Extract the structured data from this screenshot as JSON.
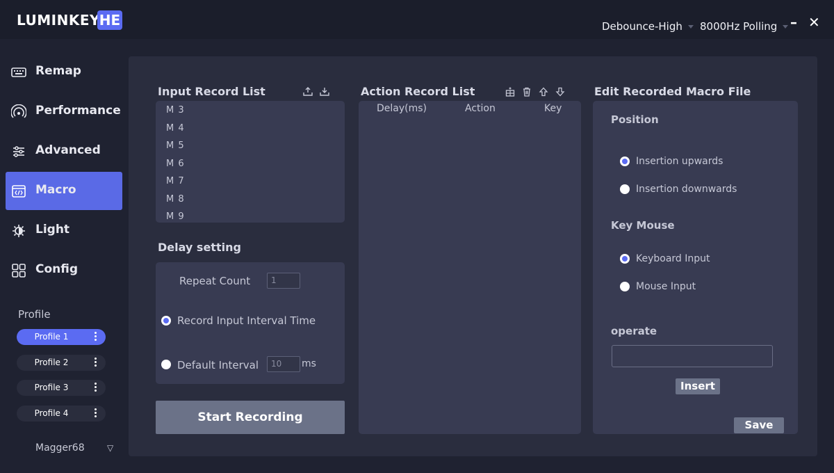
{
  "app": {
    "logo": "LUMINKEY",
    "logo_badge": "HE"
  },
  "titlebar": {
    "debounce": "Debounce-High",
    "polling": "8000Hz Polling",
    "minimize": "–",
    "close": "✕"
  },
  "sidebar": {
    "items": [
      {
        "label": "Remap",
        "icon": "keyboard-icon"
      },
      {
        "label": "Performance",
        "icon": "signal-icon"
      },
      {
        "label": "Advanced",
        "icon": "sliders-icon"
      },
      {
        "label": "Macro",
        "icon": "code-window-icon",
        "active": true
      },
      {
        "label": "Light",
        "icon": "sun-icon"
      },
      {
        "label": "Config",
        "icon": "grid-icon"
      }
    ],
    "profile_title": "Profile",
    "profiles": [
      "Profile 1",
      "Profile 2",
      "Profile 3",
      "Profile 4"
    ],
    "device": "Magger68",
    "device_caret": "▽"
  },
  "input_record": {
    "title": "Input Record List",
    "items": [
      "M 3",
      "M 4",
      "M 5",
      "M 6",
      "M 7",
      "M 8",
      "M 9"
    ]
  },
  "delay": {
    "title": "Delay setting",
    "repeat_label": "Repeat Count",
    "repeat_value": "1",
    "record_interval_label": "Record Input Interval Time",
    "default_interval_label": "Default Interval",
    "default_interval_value": "10",
    "unit": "ms"
  },
  "start_recording": "Start Recording",
  "action_record": {
    "title": "Action Record List",
    "columns": [
      "Delay(ms)",
      "Action",
      "Key"
    ]
  },
  "edit_macro": {
    "title": "Edit Recorded Macro File",
    "position_title": "Position",
    "insert_up": "Insertion upwards",
    "insert_down": "Insertion downwards",
    "keymouse_title": "Key Mouse",
    "keyboard_input": "Keyboard Input",
    "mouse_input": "Mouse Input",
    "operate_title": "operate",
    "insert_btn": "Insert",
    "save_btn": "Save"
  },
  "colors": {
    "accent": "#5b6bf2",
    "nav_active": "#5a6ae6",
    "panel": "#2a2d3e",
    "box": "#383b52"
  }
}
